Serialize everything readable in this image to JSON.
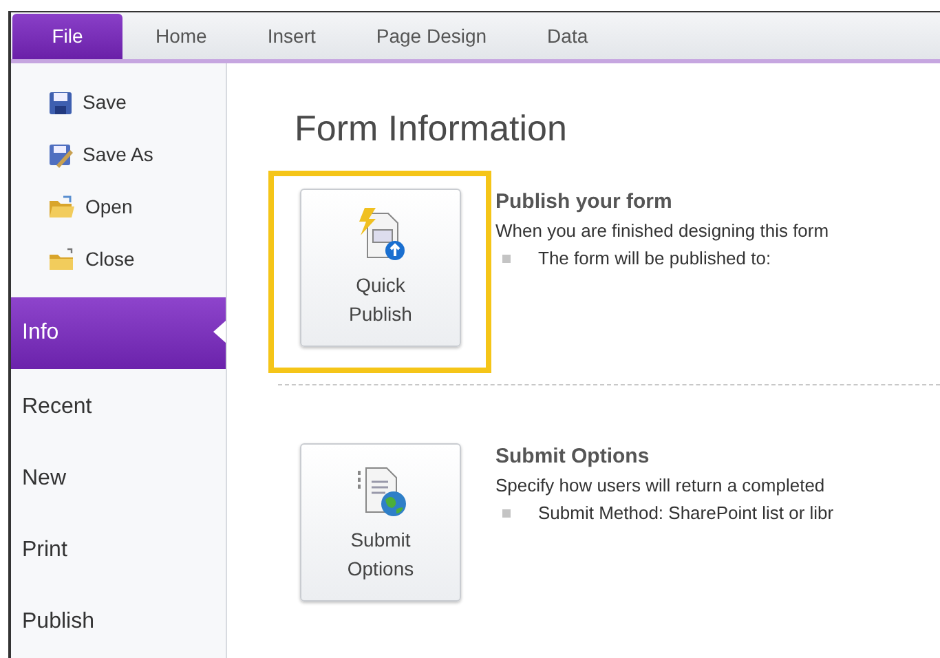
{
  "tabs": [
    {
      "label": "File",
      "selected": true
    },
    {
      "label": "Home",
      "selected": false
    },
    {
      "label": "Insert",
      "selected": false
    },
    {
      "label": "Page Design",
      "selected": false
    },
    {
      "label": "Data",
      "selected": false
    }
  ],
  "sidebar": {
    "items": [
      {
        "label": "Save",
        "kind": "command",
        "selected": false
      },
      {
        "label": "Save As",
        "kind": "command",
        "selected": false
      },
      {
        "label": "Open",
        "kind": "command",
        "selected": false
      },
      {
        "label": "Close",
        "kind": "command",
        "selected": false
      },
      {
        "label": "Info",
        "kind": "page",
        "selected": true
      },
      {
        "label": "Recent",
        "kind": "page",
        "selected": false
      },
      {
        "label": "New",
        "kind": "page",
        "selected": false
      },
      {
        "label": "Print",
        "kind": "page",
        "selected": false
      },
      {
        "label": "Publish",
        "kind": "page",
        "selected": false
      }
    ]
  },
  "main": {
    "title": "Form Information",
    "sections": [
      {
        "button": "Quick Publish",
        "highlighted": true,
        "title": "Publish your form",
        "description": "When you are finished designing this form",
        "bullet": "The form will be published to:"
      },
      {
        "button": "Submit Options",
        "highlighted": false,
        "title": "Submit Options",
        "description": "Specify how users will return a completed",
        "bullet": "Submit Method: SharePoint list or libr"
      }
    ]
  }
}
